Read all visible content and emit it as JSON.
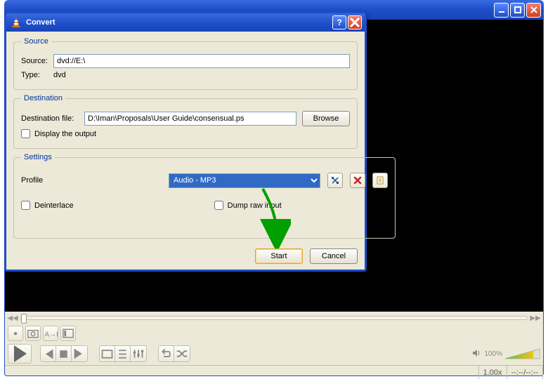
{
  "parent_window": {
    "title": ""
  },
  "dialog": {
    "title": "Convert",
    "source_group": {
      "legend": "Source",
      "source_label": "Source:",
      "source_value": "dvd://E:\\",
      "type_label": "Type:",
      "type_value": "dvd"
    },
    "dest_group": {
      "legend": "Destination",
      "dest_label": "Destination file:",
      "dest_value": "D:\\Iman\\Proposals\\User Guide\\consensual.ps",
      "browse_label": "Browse",
      "display_output_label": "Display the output"
    },
    "settings_group": {
      "legend": "Settings",
      "profile_label": "Profile",
      "profile_value": "Audio - MP3",
      "profile_options": [
        "Audio - MP3"
      ],
      "deinterlace_label": "Deinterlace",
      "dump_raw_label": "Dump raw input"
    },
    "buttons": {
      "start": "Start",
      "cancel": "Cancel"
    }
  },
  "player_controls": {
    "volume_pct": "100%",
    "speed": "1.00x",
    "time": "--:--/--:--"
  }
}
